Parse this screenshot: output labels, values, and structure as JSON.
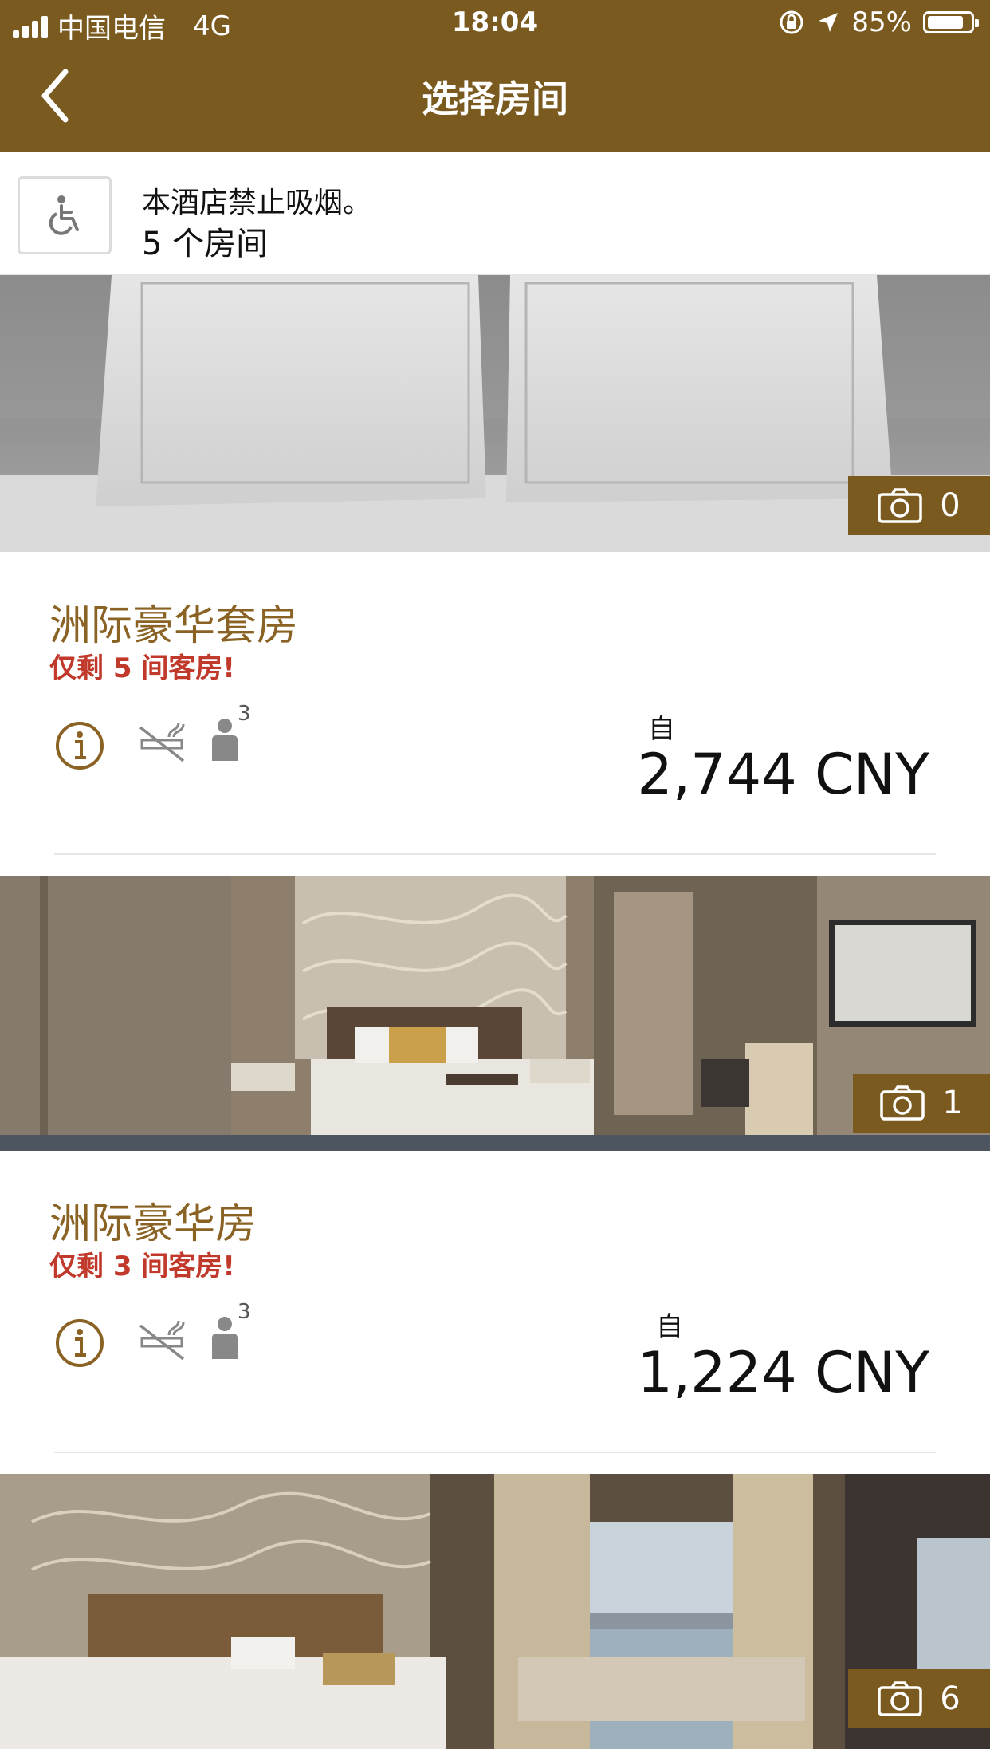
{
  "status_bar": {
    "carrier": "中国电信",
    "network": "4G",
    "time": "18:04",
    "battery_percent": "85%",
    "battery_level": 0.85
  },
  "nav": {
    "title": "选择房间",
    "back_icon": "chevron-left-icon"
  },
  "hotel_info": {
    "policy": "本酒店禁止吸烟。",
    "room_count": "5 个房间",
    "icon": "wheelchair-accessible-icon"
  },
  "rooms": [
    {
      "photo_count": "0"
    },
    {
      "name": "洲际豪华套房",
      "availability": "仅剩 5 间客房!",
      "occupancy": "3",
      "from_label": "自",
      "price": "2,744 CNY",
      "photo_count": "1"
    },
    {
      "name": "洲际豪华房",
      "availability": "仅剩 3 间客房!",
      "occupancy": "3",
      "from_label": "自",
      "price": "1,224 CNY",
      "photo_count": "6"
    }
  ],
  "colors": {
    "brand": "#7a5a1e",
    "room_name": "#8a6324",
    "availability": "#c0392b"
  }
}
